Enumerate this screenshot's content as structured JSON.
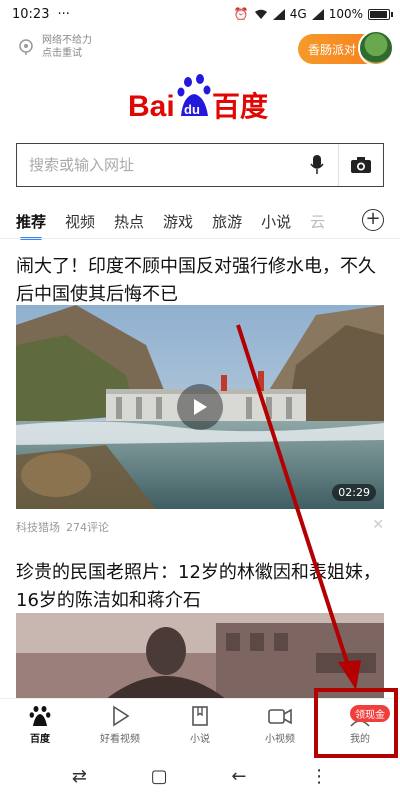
{
  "status_bar": {
    "time": "10:23",
    "dots": "···",
    "network": "4G",
    "battery_text": "100%",
    "battery_level": 1.0
  },
  "header": {
    "net_warning_line1": "网络不给力",
    "net_warning_line2": "点击重试",
    "party_button": "香肠派对",
    "logo_text_bai": "Bai",
    "logo_text_du": "du",
    "logo_text_cn": "百度"
  },
  "search": {
    "placeholder": "搜索或输入网址"
  },
  "tabs": {
    "items": [
      "推荐",
      "视频",
      "热点",
      "游戏",
      "旅游",
      "小说",
      "云"
    ],
    "active": "推荐"
  },
  "feed": {
    "articles": [
      {
        "title": "闹大了！印度不顾中国反对强行修水电，不久后中国使其后悔不已",
        "duration": "02:29",
        "source": "科技猎场",
        "comments": "274评论"
      },
      {
        "title": "珍贵的民国老照片：12岁的林徽因和表姐妹，16岁的陈洁如和蒋介石"
      }
    ]
  },
  "bottom_nav": {
    "items": [
      {
        "label": "百度",
        "icon": "baidu-paw-icon"
      },
      {
        "label": "好看视频",
        "icon": "play-triangle-icon"
      },
      {
        "label": "小说",
        "icon": "book-icon"
      },
      {
        "label": "小视频",
        "icon": "video-camera-icon"
      },
      {
        "label": "我的",
        "icon": "person-icon"
      }
    ],
    "promo_badge": "领现金"
  },
  "system_nav": {
    "back": "⇄",
    "home": "▢",
    "recent": "←",
    "menu": "⋮"
  },
  "colors": {
    "baidu_red": "#e10602",
    "baidu_blue": "#2319dc",
    "accent_blue": "#3385ff",
    "party_orange": "#f7891f",
    "annotation_red": "#b30000"
  }
}
